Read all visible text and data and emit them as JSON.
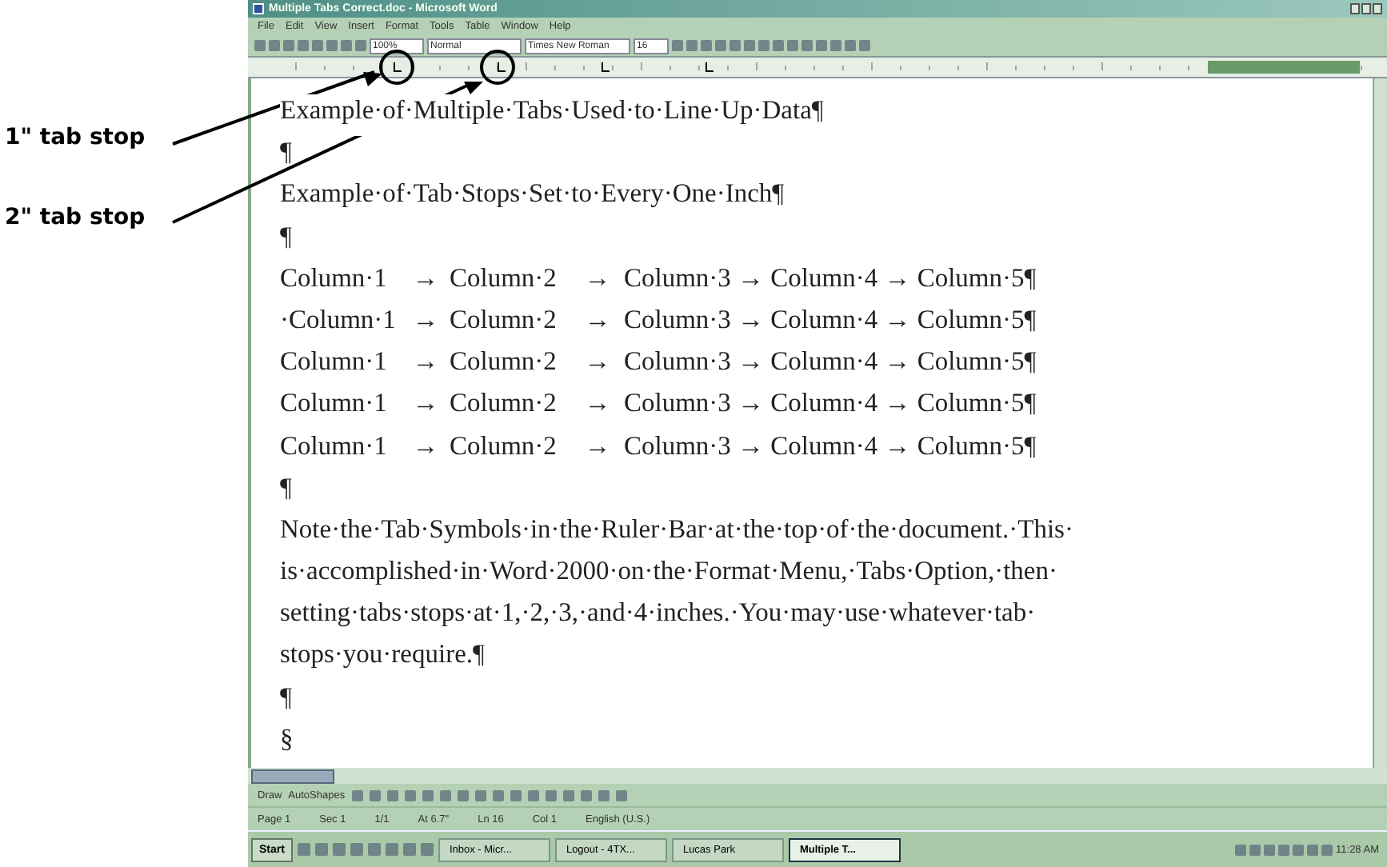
{
  "annotations": [
    {
      "label": "1\" tab stop"
    },
    {
      "label": "2\" tab stop"
    }
  ],
  "window": {
    "title": "Multiple Tabs Correct.doc - Microsoft Word"
  },
  "menu": [
    "File",
    "Edit",
    "View",
    "Insert",
    "Format",
    "Tools",
    "Table",
    "Window",
    "Help"
  ],
  "toolbar": {
    "zoom": "100%",
    "style": "Normal",
    "font": "Times New Roman",
    "size": "16"
  },
  "document": {
    "lines": [
      {
        "kind": "text",
        "text": "Example·of·Multiple·Tabs·Used·to·Line·Up·Data¶"
      },
      {
        "kind": "text",
        "text": "¶"
      },
      {
        "kind": "text",
        "text": "Example·of·Tab·Stops·Set·to·Every·One·Inch¶"
      },
      {
        "kind": "text",
        "text": "¶"
      },
      {
        "kind": "row",
        "cells": [
          "Column·1",
          "→",
          "Column·2",
          "→",
          "Column·3 → Column·4 → Column·5¶"
        ]
      },
      {
        "kind": "row",
        "cells": [
          "·Column·1",
          "→",
          "Column·2",
          "→",
          "Column·3 → Column·4 → Column·5¶"
        ]
      },
      {
        "kind": "row",
        "cells": [
          "Column·1",
          "→",
          "Column·2",
          "→",
          "Column·3 → Column·4 → Column·5¶"
        ]
      },
      {
        "kind": "row",
        "cells": [
          "Column·1",
          "→",
          "Column·2",
          "→",
          "Column·3 → Column·4 → Column·5¶"
        ]
      },
      {
        "kind": "row",
        "cells": [
          "Column·1",
          "→",
          "Column·2",
          "→",
          "Column·3 → Column·4 → Column·5¶"
        ]
      },
      {
        "kind": "text",
        "text": "¶"
      },
      {
        "kind": "text",
        "text": "Note·the·Tab·Symbols·in·the·Ruler·Bar·at·the·top·of·the·document.·This·"
      },
      {
        "kind": "text",
        "text": "is·accomplished·in·Word·2000·on·the·Format·Menu,·Tabs·Option,·then·"
      },
      {
        "kind": "text",
        "text": "setting·tabs·stops·at·1,·2,·3,·and·4·inches.·You·may·use·whatever·tab·"
      },
      {
        "kind": "text",
        "text": "stops·you·require.¶"
      },
      {
        "kind": "text",
        "text": "¶"
      },
      {
        "kind": "text",
        "text": "§"
      }
    ]
  },
  "drawing_toolbar": [
    "Draw",
    "AutoShapes"
  ],
  "status_bar": [
    "Page 1",
    "Sec 1",
    "1/1",
    "At 6.7\"",
    "Ln 16",
    "Col 1",
    "English (U.S.)"
  ],
  "taskbar": {
    "start": "Start",
    "tasks": [
      {
        "label": "Inbox - Micr...",
        "selected": false
      },
      {
        "label": "Logout - 4TX...",
        "selected": false
      },
      {
        "label": "Lucas Park",
        "selected": false
      },
      {
        "label": "Multiple T...",
        "selected": true
      }
    ],
    "clock": "11:28 AM"
  }
}
